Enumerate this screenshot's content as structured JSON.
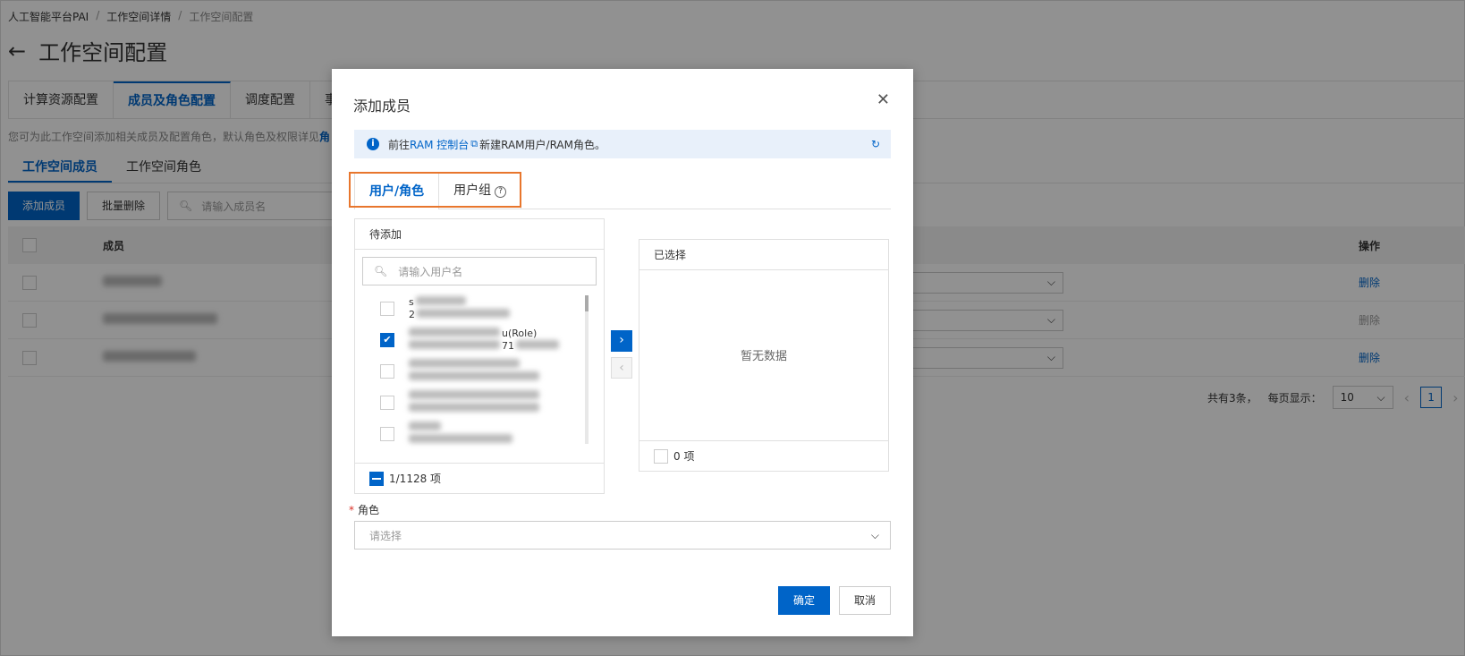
{
  "breadcrumb": [
    "人工智能平台PAI",
    "工作空间详情",
    "工作空间配置"
  ],
  "page_title": "工作空间配置",
  "tabs": [
    {
      "label": "计算资源配置",
      "active": false
    },
    {
      "label": "成员及角色配置",
      "active": true
    },
    {
      "label": "调度配置",
      "active": false
    },
    {
      "label": "事",
      "active": false
    }
  ],
  "description": {
    "text": "您可为此工作空间添加相关成员及配置角色，默认角色及权限详见",
    "link": "角"
  },
  "subtabs": [
    {
      "label": "工作空间成员",
      "active": true
    },
    {
      "label": "工作空间角色",
      "active": false
    }
  ],
  "toolbar": {
    "add_label": "添加成员",
    "bulk_delete_label": "批量删除",
    "search_placeholder": "请输入成员名"
  },
  "table": {
    "col_member": "成员",
    "col_op": "操作",
    "rows": [
      {
        "op": "删除",
        "disabled": false
      },
      {
        "op": "删除",
        "disabled": true
      },
      {
        "op": "删除",
        "disabled": false
      }
    ]
  },
  "pager": {
    "total_text": "共有3条，",
    "per_page_label": "每页显示：",
    "per_page": "10",
    "page": "1"
  },
  "modal": {
    "title": "添加成员",
    "notice": {
      "prefix": "前往",
      "link": "RAM 控制台",
      "suffix": "新建RAM用户/RAM角色。"
    },
    "tabs": [
      {
        "label": "用户/角色",
        "active": true
      },
      {
        "label": "用户组",
        "active": false
      }
    ],
    "left_panel": {
      "title": "待添加",
      "search_placeholder": "请输入用户名",
      "items": [
        {
          "line1": "s",
          "line2": "2",
          "checked": false
        },
        {
          "line1": "u(Role)",
          "line2": "71",
          "checked": true
        },
        {
          "line1": "",
          "line2": "",
          "checked": false
        },
        {
          "line1": "",
          "line2": "",
          "checked": false
        },
        {
          "line1": "",
          "line2": "",
          "checked": false
        }
      ],
      "count": "1/1128 项"
    },
    "right_panel": {
      "title": "已选择",
      "empty_text": "暂无数据",
      "count": "0 项"
    },
    "role": {
      "label": "角色",
      "placeholder": "请选择"
    },
    "ok_label": "确定",
    "cancel_label": "取消"
  },
  "colors": {
    "primary": "#0064c8",
    "highlight": "#e8762d",
    "required": "#d93026"
  }
}
